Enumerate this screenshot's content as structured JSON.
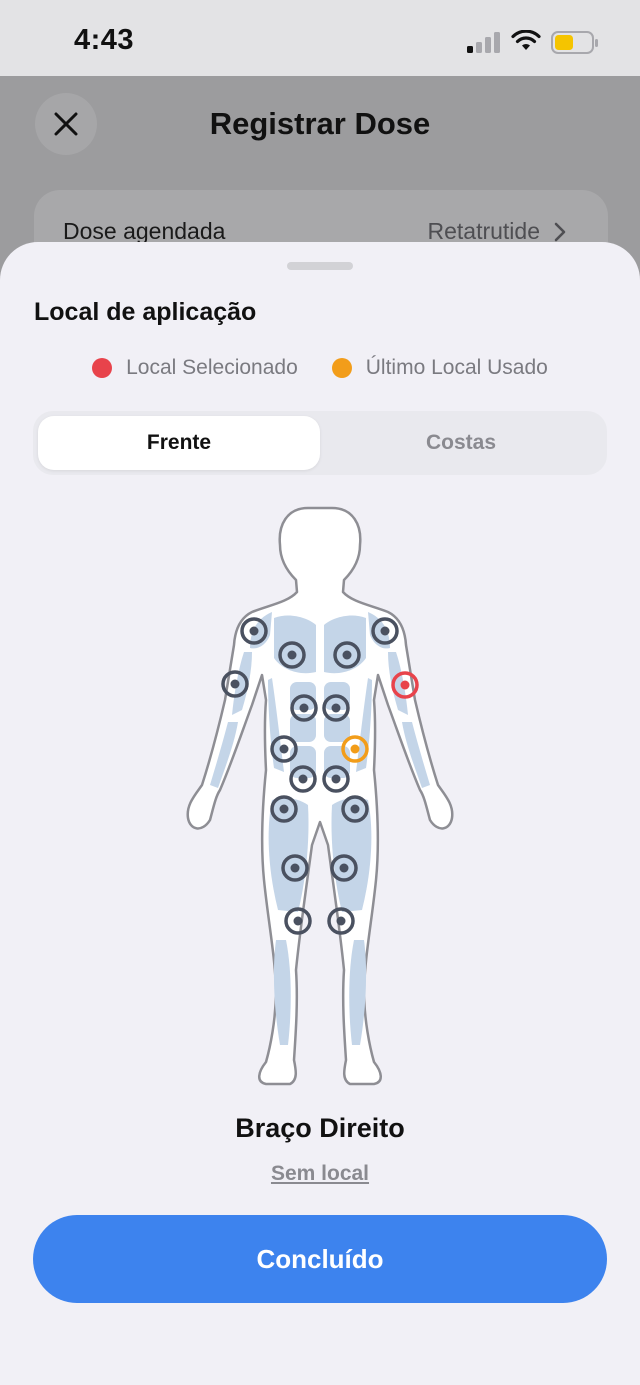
{
  "status_bar": {
    "time": "4:43"
  },
  "header": {
    "title": "Registrar Dose"
  },
  "scheduled": {
    "label": "Dose agendada",
    "value": "Retatrutide"
  },
  "sheet": {
    "title": "Local de aplicação",
    "legend": {
      "selected_label": "Local Selecionado",
      "selected_color": "#e8434b",
      "last_label": "Último Local Usado",
      "last_color": "#f29d1a"
    },
    "tabs": {
      "front": "Frente",
      "back": "Costas",
      "active": "Frente"
    },
    "body_view": {
      "selected_site": "Braço Direito",
      "last_used_site_color": "#f29d1a",
      "site_marker_color": "#4a5160"
    },
    "selected_site_name": "Braço Direito",
    "no_site_link": "Sem local",
    "done_button": "Concluído"
  },
  "colors": {
    "accent": "#3d83ee",
    "sheet_bg": "#f1f0f6"
  }
}
